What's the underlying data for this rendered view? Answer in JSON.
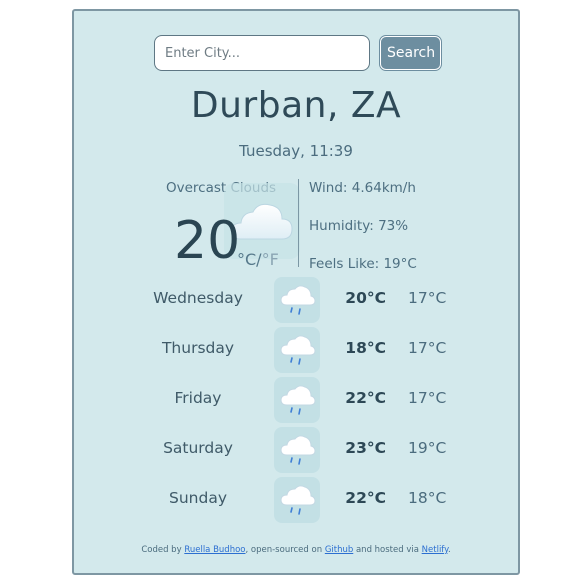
{
  "search": {
    "placeholder": "Enter City...",
    "button_label": "Search"
  },
  "current": {
    "city": "Durban, ZA",
    "datetime": "Tuesday, 11:39",
    "description": "Overcast Clouds",
    "temperature": "20",
    "unit_c": "°C",
    "unit_sep": "/",
    "unit_f": "°F",
    "icon": "cloud-icon",
    "wind": "Wind: 4.64km/h",
    "humidity": "Humidity: 73%",
    "feels_like": "Feels Like: 19°C"
  },
  "forecast": [
    {
      "day": "Wednesday",
      "icon": "rain-cloud-icon",
      "high": "20°C",
      "low": "17°C"
    },
    {
      "day": "Thursday",
      "icon": "rain-cloud-icon",
      "high": "18°C",
      "low": "17°C"
    },
    {
      "day": "Friday",
      "icon": "rain-cloud-icon",
      "high": "22°C",
      "low": "17°C"
    },
    {
      "day": "Saturday",
      "icon": "rain-cloud-icon",
      "high": "23°C",
      "low": "19°C"
    },
    {
      "day": "Sunday",
      "icon": "rain-cloud-icon",
      "high": "22°C",
      "low": "18°C"
    }
  ],
  "footer": {
    "prefix": "Coded by",
    "author": "Ruella Budhoo",
    "mid": ", open-sourced on",
    "github": "Github",
    "and": "and hosted via",
    "netlify": "Netlify",
    "end": "."
  }
}
